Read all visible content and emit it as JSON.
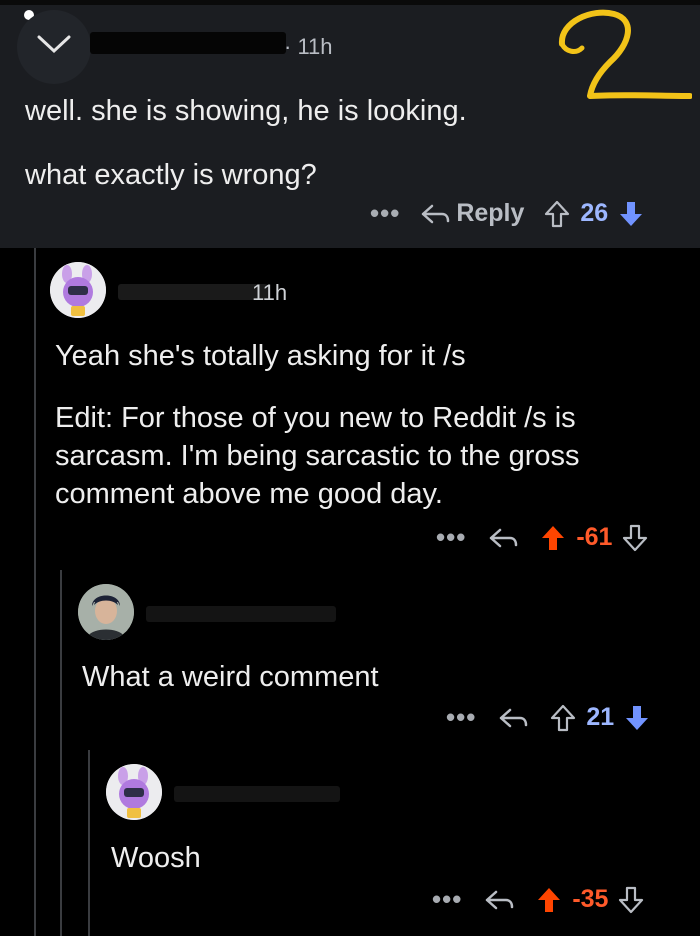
{
  "comments": [
    {
      "timestamp": "· 11h",
      "paragraphs": [
        "well. she is showing, he is looking.",
        "what exactly is wrong?"
      ],
      "reply_label": "Reply",
      "score": "26",
      "vote": "down",
      "annotation": "2"
    },
    {
      "timestamp": "11h",
      "paragraphs": [
        "Yeah she's totally asking for it /s",
        "Edit: For those of you new to Reddit /s is sarcasm. I'm being sarcastic to the gross comment above me good day."
      ],
      "score": "-61",
      "vote": "up"
    },
    {
      "paragraphs": [
        "What a weird comment"
      ],
      "score": "21",
      "vote": "down"
    },
    {
      "paragraphs": [
        "Woosh"
      ],
      "score": "-35",
      "vote": "up"
    }
  ],
  "more_dots": "•••",
  "colors": {
    "upvote": "#ff4500",
    "downvote": "#7193ff",
    "background": "#000000",
    "highlight": "#1b1d21"
  }
}
